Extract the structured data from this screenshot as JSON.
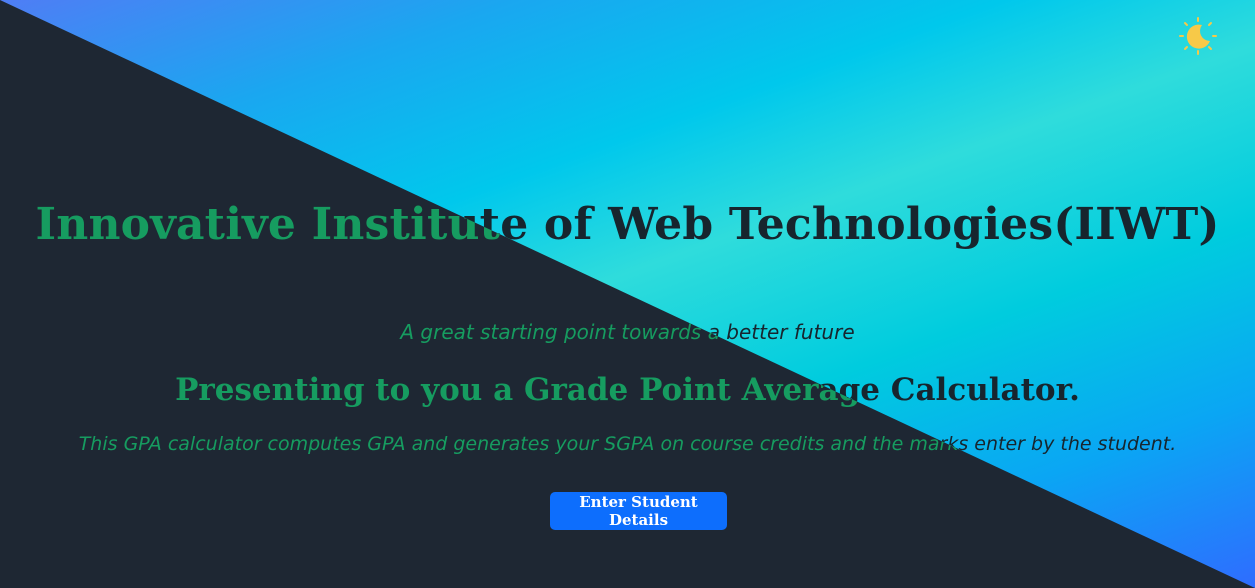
{
  "hero": {
    "title": "Innovative Institute of Web Technologies(IIWT)",
    "tagline": "A great starting point towards a better future",
    "heading": "Presenting to you a Grade Point Average Calculator.",
    "description": "This GPA calculator computes GPA and generates your SGPA on course credits and the marks enter by the student."
  },
  "cta": {
    "label": "Enter Student Details"
  },
  "theme_toggle": {
    "icon": "moon-sun-icon"
  },
  "colors": {
    "dark_bg": "#1e2733",
    "green_text": "#169c60",
    "dark_text": "#17252e",
    "button": "#0d6efd",
    "icon": "#f7c948"
  }
}
